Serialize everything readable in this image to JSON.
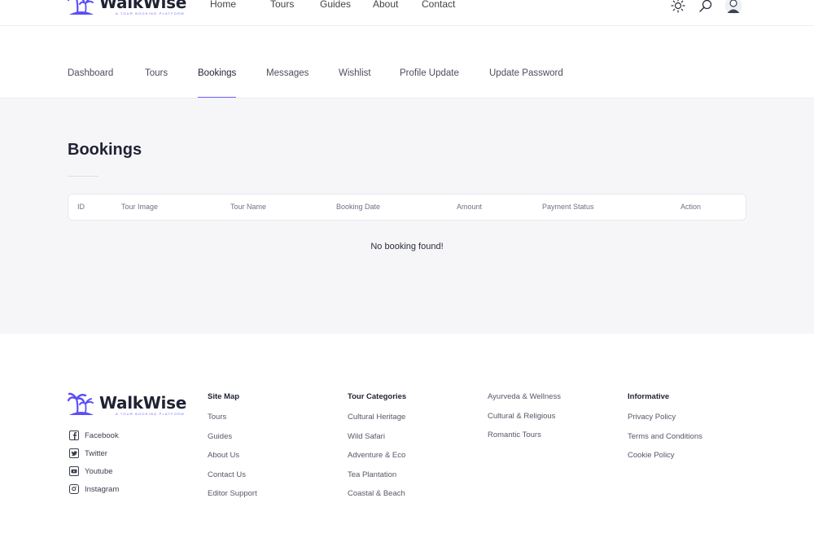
{
  "brand": {
    "name": "WalkWise",
    "tagline": "A TOUR BOOKING PLATFORM"
  },
  "nav": {
    "items": [
      "Home",
      "Tours",
      "Guides",
      "About",
      "Contact"
    ]
  },
  "header_icons": [
    "sun-icon",
    "search-icon",
    "user-avatar"
  ],
  "tabs": [
    "Dashboard",
    "Tours",
    "Bookings",
    "Messages",
    "Wishlist",
    "Profile Update",
    "Update Password"
  ],
  "active_tab": "Bookings",
  "page": {
    "title": "Bookings"
  },
  "table": {
    "columns": [
      "ID",
      "Tour Image",
      "Tour Name",
      "Booking Date",
      "Amount",
      "Payment Status",
      "Action"
    ],
    "empty_message": "No booking found!"
  },
  "footer": {
    "social": [
      "Facebook",
      "Twitter",
      "Youtube",
      "Instagram"
    ],
    "sitemap": {
      "title": "Site Map",
      "links": [
        "Tours",
        "Guides",
        "About Us",
        "Contact Us",
        "Editor Support"
      ]
    },
    "categories": {
      "title": "Tour Categories",
      "links": [
        "Cultural Heritage",
        "Wild Safari",
        "Adventure & Eco",
        "Tea Plantation",
        "Coastal & Beach"
      ]
    },
    "categories2": {
      "links": [
        "Ayurveda & Wellness",
        "Cultural & Religious",
        "Romantic Tours"
      ]
    },
    "informative": {
      "title": "Informative",
      "links": [
        "Privacy Policy",
        "Terms and Conditions",
        "Cookie Policy"
      ]
    }
  },
  "colors": {
    "accent": "#6c63ff",
    "text": "#1f2233",
    "content_bg": "#f6f6f9"
  }
}
